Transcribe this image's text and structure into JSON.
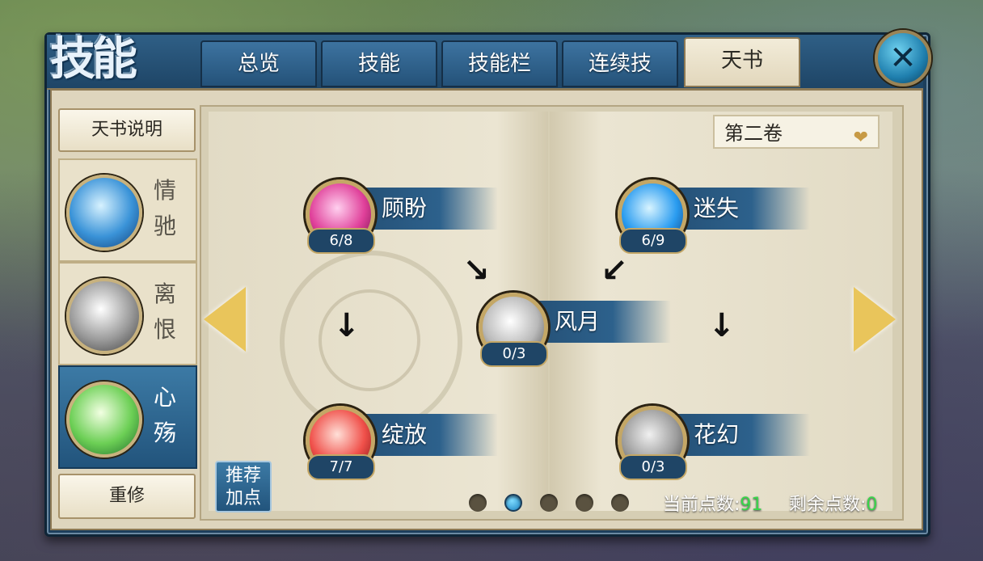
{
  "window": {
    "title": "技能",
    "close_icon": "close-x-icon"
  },
  "tabs": [
    {
      "label": "总览",
      "active": false
    },
    {
      "label": "技能",
      "active": false
    },
    {
      "label": "技能栏",
      "active": false
    },
    {
      "label": "连续技",
      "active": false
    },
    {
      "label": "天书",
      "active": true
    }
  ],
  "sidebar": {
    "top_button": "天书说明",
    "categories": [
      {
        "label_top": "情",
        "label_bottom": "驰",
        "icon": "blue-lotus-emblem-icon",
        "active": false
      },
      {
        "label_top": "离",
        "label_bottom": "恨",
        "icon": "grey-lotus-emblem-icon",
        "active": false
      },
      {
        "label_top": "心",
        "label_bottom": "殇",
        "icon": "green-lotus-emblem-icon",
        "active": true
      }
    ],
    "bottom_button": "重修"
  },
  "book": {
    "volume_select": "第二卷",
    "skills": [
      {
        "name": "顾盼",
        "level": "6/8",
        "icon": "pink-flower-icon"
      },
      {
        "name": "迷失",
        "level": "6/9",
        "icon": "blue-crystal-icon"
      },
      {
        "name": "风月",
        "level": "0/3",
        "icon": "moon-icon"
      },
      {
        "name": "绽放",
        "level": "7/7",
        "icon": "red-lotus-icon"
      },
      {
        "name": "花幻",
        "level": "0/3",
        "icon": "grey-flower-icon"
      }
    ],
    "recommend_button": {
      "line1": "推荐",
      "line2": "加点"
    },
    "page_dots": {
      "count": 5,
      "active_index": 1
    },
    "current_points_label": "当前点数:",
    "current_points_value": "91",
    "remaining_points_label": "剩余点数:",
    "remaining_points_value": "0"
  },
  "colors": {
    "accent_blue": "#2d618c",
    "gold": "#c4a766",
    "points_green": "#38d64a",
    "parchment": "#e2dbc5"
  }
}
